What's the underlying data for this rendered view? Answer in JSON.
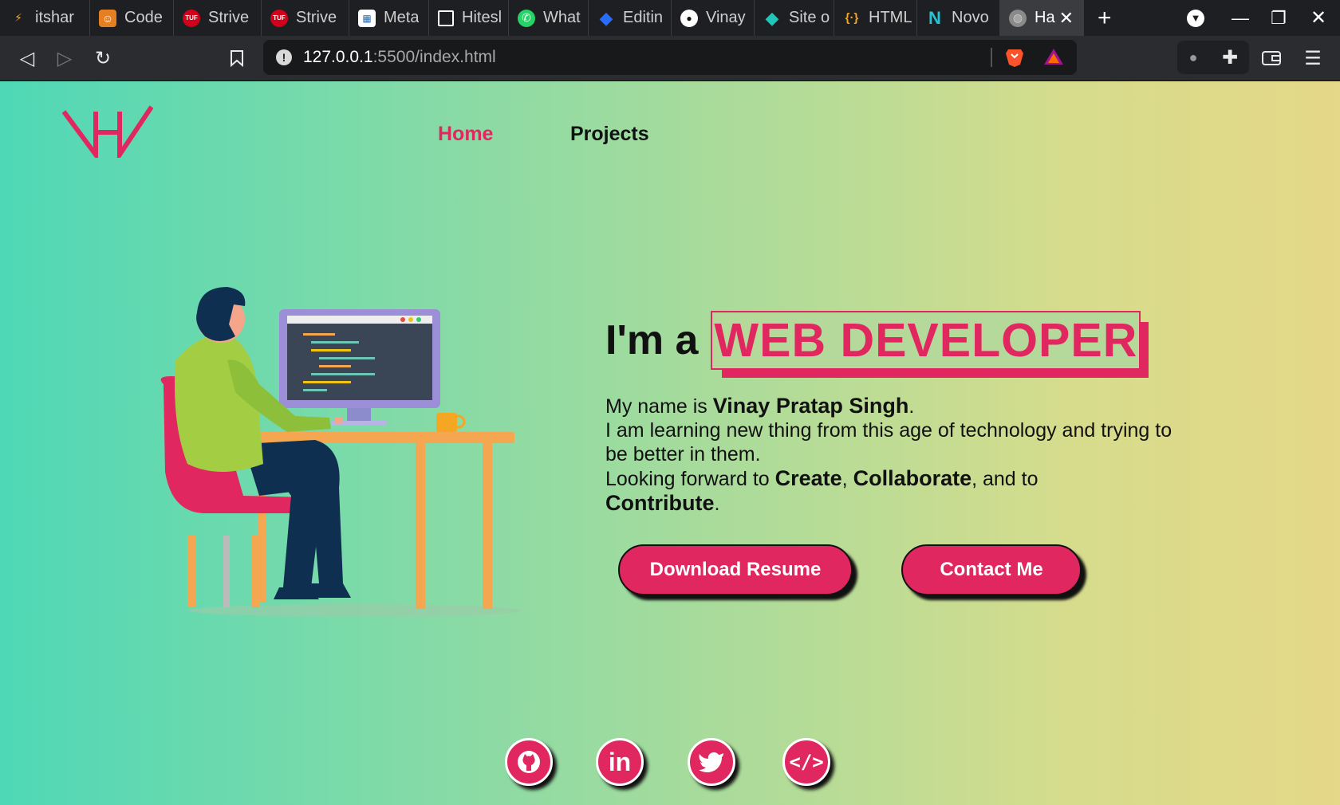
{
  "browser": {
    "tabs": [
      {
        "title": "itshar",
        "icon": "bolt-icon"
      },
      {
        "title": "Code",
        "icon": "codechef-icon"
      },
      {
        "title": "Strive",
        "icon": "tuf-icon"
      },
      {
        "title": "Strive",
        "icon": "tuf-icon"
      },
      {
        "title": "Meta",
        "icon": "meta-icon"
      },
      {
        "title": "Hitesl",
        "icon": "square-icon"
      },
      {
        "title": "What",
        "icon": "whatsapp-icon"
      },
      {
        "title": "Editin",
        "icon": "diamond-icon"
      },
      {
        "title": "Vinay",
        "icon": "github-icon"
      },
      {
        "title": "Site o",
        "icon": "netlify-icon"
      },
      {
        "title": "HTML",
        "icon": "code-braces-icon"
      },
      {
        "title": "Novo",
        "icon": "novo-icon"
      },
      {
        "title": "Ha",
        "icon": "globe-icon"
      }
    ],
    "url_host": "127.0.0.1",
    "url_path": ":5500/index.html"
  },
  "nav": {
    "home": "Home",
    "projects": "Projects"
  },
  "hero": {
    "prefix": "I'm a",
    "role": "WEB DEVELOPER",
    "line1_a": "My name is ",
    "name": "Vinay Pratap Singh",
    "line1_b": ".",
    "line2": "I am learning new thing from this age of technology and trying to be better in them.",
    "line3_a": "Looking forward to ",
    "w1": "Create",
    "comma": ", ",
    "w2": "Collaborate",
    "line3_b": ", and to",
    "w3": "Contribute",
    "dot": "."
  },
  "buttons": {
    "resume": "Download Resume",
    "contact": "Contact Me"
  },
  "social": [
    "github-icon",
    "linkedin-icon",
    "twitter-icon",
    "code-icon"
  ],
  "colors": {
    "accent": "#e0275f",
    "gradient_start": "#4fd8b6",
    "gradient_end": "#e5d888"
  }
}
